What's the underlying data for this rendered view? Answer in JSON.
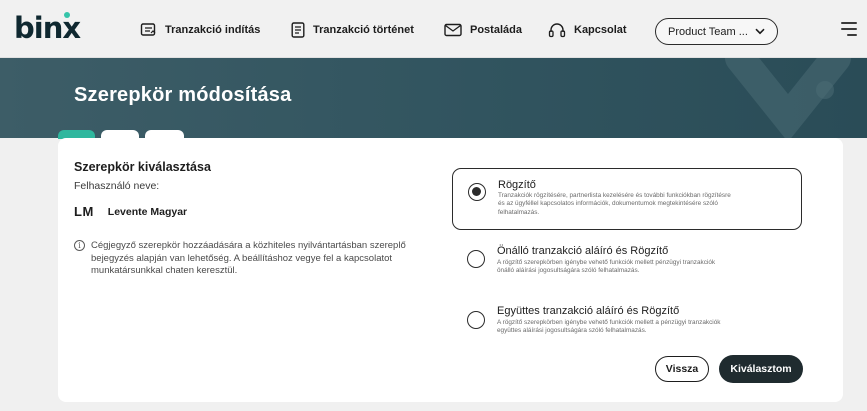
{
  "logo": {
    "text": "binx"
  },
  "nav": {
    "items": [
      {
        "label": "Tranzakció indítás",
        "icon": "transaction-start-icon"
      },
      {
        "label": "Tranzakció történet",
        "icon": "document-list-icon"
      },
      {
        "label": "Postaláda",
        "icon": "envelope-icon"
      },
      {
        "label": "Kapcsolat",
        "icon": "headset-icon"
      }
    ],
    "team_select": {
      "value": "Product Team ...",
      "icon": "chevron-down-icon"
    },
    "menu_icon": "hamburger-menu-icon"
  },
  "hero": {
    "title": "Szerepkör módosítása"
  },
  "tabs": [
    {
      "state": "active"
    },
    {
      "state": "inactive"
    },
    {
      "state": "inactive"
    }
  ],
  "section": {
    "title": "Szerepkör kiválasztása",
    "user_label": "Felhasználó neve:",
    "user_initials": "LM",
    "user_name": "Levente Magyar",
    "info_line1": "Cégjegyző szerepkör hozzáadására a közhiteles nyilvántartásban szereplő",
    "info_line2": "bejegyzés alapján van lehetőség. A beállításhoz vegye fel a kapcsolatot",
    "info_line3": "munkatársunkkal chaten keresztül."
  },
  "roles": [
    {
      "title": "Rögzítő",
      "desc_line1": "Tranzakciók rögzítésére, partnerlista kezelésére és további funkciókban rögzítésre",
      "desc_line2": "és az ügyféllel kapcsolatos információk, dokumentumok megtekintésére szóló",
      "desc_line3": "felhatalmazás.",
      "selected": true
    },
    {
      "title": "Önálló tranzakció aláíró és Rögzítő",
      "desc_line1": "A rögzítő szerepkörben igénybe vehető funkciók mellett pénzügyi tranzakciók",
      "desc_line2": "önálló aláírási jogosultságára szóló felhatalmazás.",
      "desc_line3": "",
      "selected": false
    },
    {
      "title": "Együttes tranzakció aláíró és Rögzítő",
      "desc_line1": "A rögzítő szerepkörben igénybe vehető funkciók mellett a pénzügyi tranzakciók",
      "desc_line2": "együttes aláírási jogosultságára szóló felhatalmazás.",
      "desc_line3": "",
      "selected": false
    }
  ],
  "buttons": {
    "back": "Vissza",
    "choose": "Kiválasztom"
  },
  "colors": {
    "accent": "#2fb79e",
    "hero": "#31545f",
    "dark_button": "#1f2b2f"
  }
}
